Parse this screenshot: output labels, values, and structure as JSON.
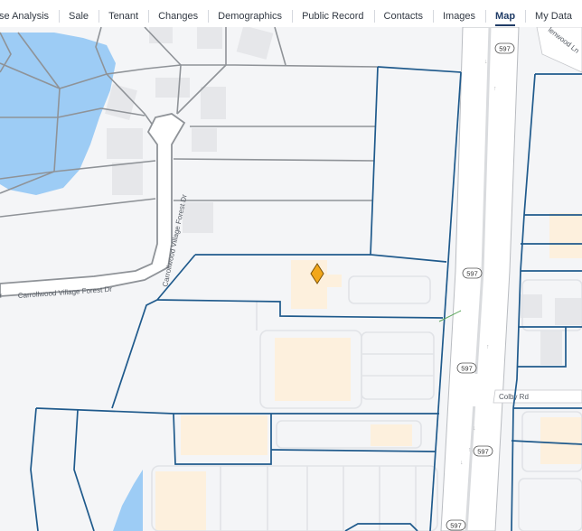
{
  "tabs": [
    {
      "label": "se Analysis",
      "active": false
    },
    {
      "label": "Sale",
      "active": false
    },
    {
      "label": "Tenant",
      "active": false
    },
    {
      "label": "Changes",
      "active": false
    },
    {
      "label": "Demographics",
      "active": false
    },
    {
      "label": "Public Record",
      "active": false
    },
    {
      "label": "Contacts",
      "active": false
    },
    {
      "label": "Images",
      "active": false
    },
    {
      "label": "Map",
      "active": true
    },
    {
      "label": "My Data",
      "active": false
    }
  ],
  "map": {
    "street_labels": {
      "carrollwood_village_forest_dr_1": "Carrollwood Village Forest Dr",
      "carrollwood_village_forest_dr_2": "Carrollwood Village Forest Dr",
      "r_fragment": "r",
      "colby_rd": "Colby Rd",
      "lenwood_ln": "lenwood Ln"
    },
    "route_shields": [
      "597",
      "597",
      "597",
      "597",
      "597"
    ],
    "marker_icon": "map-pin-icon",
    "colors": {
      "water": "#9dccf5",
      "parcel_lines": "#1f5a8c",
      "road_lines": "#9a9a9a",
      "marker": "#f2a71b",
      "building": "#fdf0dd",
      "building_gray": "#e6e7ea"
    }
  }
}
